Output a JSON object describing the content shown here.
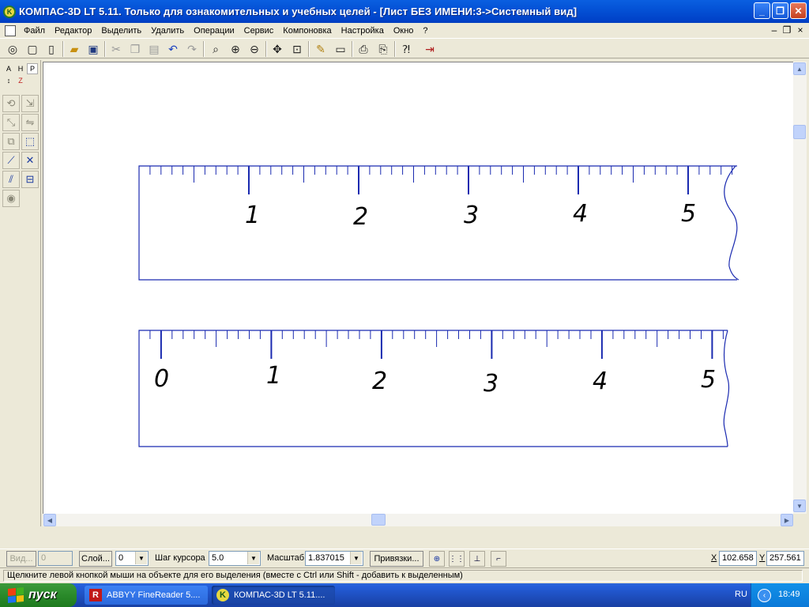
{
  "window": {
    "title": "КОМПАС-3D LT 5.11. Только для ознакомительных и учебных целей - [Лист БЕЗ ИМЕНИ:3->Системный вид]",
    "app_icon": "K",
    "controls": {
      "minimize": "_",
      "maximize": "❐",
      "close": "✕"
    }
  },
  "menu": {
    "items": [
      "Файл",
      "Редактор",
      "Выделить",
      "Удалить",
      "Операции",
      "Сервис",
      "Компоновка",
      "Настройка",
      "Окно",
      "?"
    ],
    "mdi_controls": {
      "minimize": "–",
      "restore": "❐",
      "close": "×"
    }
  },
  "toolbar": {
    "icons": [
      "drawing-icon",
      "fragment-icon",
      "new-icon",
      "open-icon",
      "save-icon",
      "cut-icon",
      "copy-icon",
      "paste-icon",
      "undo-icon",
      "redo-icon",
      "zoom-icon",
      "zoom-in-icon",
      "zoom-out-icon",
      "pan-icon",
      "zoom-all-icon",
      "pencil-icon",
      "sheet-icon",
      "print-preview-icon",
      "print-icon",
      "help-icon",
      "exit-icon"
    ]
  },
  "left_panel": {
    "tabs": [
      "A",
      "H",
      "P",
      "↕",
      "Z"
    ]
  },
  "canvas": {
    "ruler_top_labels": [
      "1",
      "2",
      "3",
      "4",
      "5"
    ],
    "ruler_bottom_labels": [
      "0",
      "1",
      "2",
      "3",
      "4",
      "5"
    ]
  },
  "property_bar": {
    "view_label": "Вид...",
    "view_value": "0",
    "layer_label": "Слой...",
    "layer_value": "0",
    "step_label": "Шаг курсора",
    "step_value": "5.0",
    "scale_label": "Масштаб",
    "scale_value": "1.837015",
    "snap_label": "Привязки...",
    "x_label": "X",
    "x_value": "102.658",
    "y_label": "Y",
    "y_value": "257.561"
  },
  "status": {
    "text": "Щелкните левой кнопкой мыши на объекте для его выделения (вместе с Ctrl или Shift - добавить к выделенным)"
  },
  "taskbar": {
    "start_label": "пуск",
    "tasks": [
      {
        "label": "ABBYY FineReader 5....",
        "icon": "R"
      },
      {
        "label": "КОМПАС-3D LT 5.11....",
        "icon": "K"
      }
    ],
    "lang": "RU",
    "time": "18:49"
  }
}
